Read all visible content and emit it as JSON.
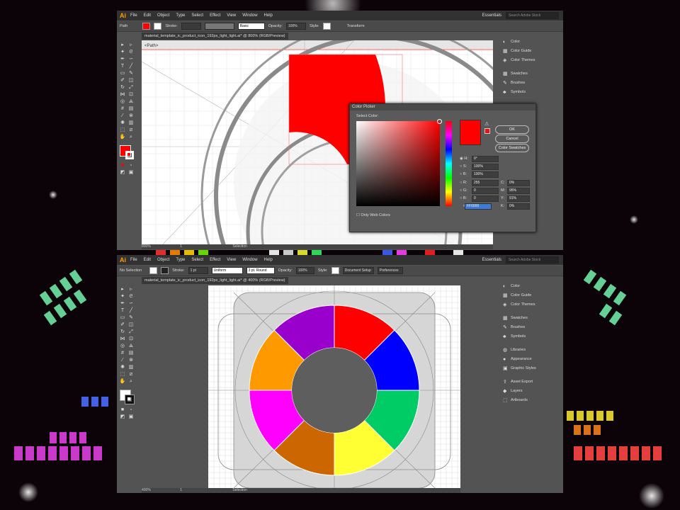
{
  "top_window": {
    "menu": [
      "File",
      "Edit",
      "Object",
      "Type",
      "Select",
      "Effect",
      "View",
      "Window",
      "Help"
    ],
    "workspace": "Essentials",
    "search_placeholder": "Search Adobe Stock",
    "control": {
      "label": "Path",
      "stroke": "Stroke:",
      "basic": "Basic",
      "opacity_label": "Opacity:",
      "opacity": "100%",
      "style": "Style:",
      "transform": "Transform"
    },
    "doc_tab": "material_template_ic_product_icon_192px_light_light.ai* @ 800% (RGB/Preview)",
    "path_crumb": "<Path>",
    "zoom": "800%",
    "page": "1",
    "status": "Selection",
    "panels": [
      "Color",
      "Color Guide",
      "Color Themes",
      "Swatches",
      "Brushes",
      "Symbols"
    ]
  },
  "color_picker": {
    "title": "Color Picker",
    "select_color": "Select Color:",
    "ok": "OK",
    "cancel": "Cancel",
    "swatches": "Color Swatches",
    "only_web": "Only Web Colors",
    "fields": {
      "H": "0°",
      "S": "100%",
      "B": "100%",
      "R": "255",
      "G": "0",
      "Bv": "0",
      "C": "0%",
      "M": "95%",
      "Y": "91%",
      "K": "0%",
      "hex": "FF0000"
    },
    "current_color": "#ff0000"
  },
  "bottom_window": {
    "menu": [
      "File",
      "Edit",
      "Object",
      "Type",
      "Select",
      "Effect",
      "View",
      "Window",
      "Help"
    ],
    "workspace": "Essentials",
    "search_placeholder": "Search Adobe Stock",
    "control": {
      "label": "No Selection",
      "stroke": "Stroke:",
      "weight": "1 pt",
      "uniform": "Uniform",
      "round": "3 pt. Round",
      "opacity_label": "Opacity:",
      "opacity": "100%",
      "style": "Style:",
      "doc_setup": "Document Setup",
      "prefs": "Preferences"
    },
    "doc_tab": "material_template_ic_product_icon_192px_light_light.ai* @ 400% (RGB/Preview)",
    "zoom": "400%",
    "page": "1",
    "status": "Selection",
    "panels": [
      "Color",
      "Color Guide",
      "Color Themes",
      "Swatches",
      "Brushes",
      "Symbols",
      "Libraries",
      "Appearance",
      "Graphic Styles",
      "Asset Export",
      "Layers",
      "Artboards"
    ]
  },
  "color_wheel": {
    "segments": [
      "#ff0000",
      "#0000ff",
      "#00cc66",
      "#ffff33",
      "#cc6600",
      "#ff00ff",
      "#ff9900",
      "#9900cc"
    ]
  }
}
